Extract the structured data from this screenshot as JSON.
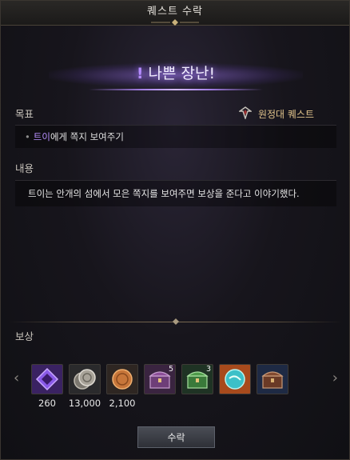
{
  "window": {
    "title": "퀘스트 수락"
  },
  "banner": {
    "headline": "나쁜 장난!",
    "exclamation": "!"
  },
  "goal": {
    "label": "목표",
    "bullet": "•",
    "highlight": "트이",
    "text": "에게 쪽지 보여주기"
  },
  "quest_type": {
    "label": "원정대 퀘스트",
    "icon": "expedition-emblem-icon"
  },
  "content": {
    "label": "내용",
    "text": "트이는 안개의 섬에서 모은 쪽지를 보여주면 보상을 준다고 이야기했다."
  },
  "rewards": {
    "label": "보상",
    "items": [
      {
        "icon": "purple-crystal-icon",
        "quantity": "260",
        "badge": "",
        "color": "#7a4fd6"
      },
      {
        "icon": "silver-coin-icon",
        "quantity": "13,000",
        "badge": "",
        "color": "#9a958c"
      },
      {
        "icon": "bronze-coin-icon",
        "quantity": "2,100",
        "badge": "",
        "color": "#c0743a"
      },
      {
        "icon": "purple-chest-icon",
        "quantity": "",
        "badge": "5",
        "color": "#7a4a8a"
      },
      {
        "icon": "green-chest-icon",
        "quantity": "",
        "badge": "3",
        "color": "#3c7a3c"
      },
      {
        "icon": "teal-orb-icon",
        "quantity": "",
        "badge": "",
        "color": "#d0662a"
      },
      {
        "icon": "brown-chest-icon",
        "quantity": "",
        "badge": "",
        "color": "#2a3a5a"
      }
    ]
  },
  "nav": {
    "prev": "‹",
    "next": "›"
  },
  "actions": {
    "accept_label": "수락"
  }
}
